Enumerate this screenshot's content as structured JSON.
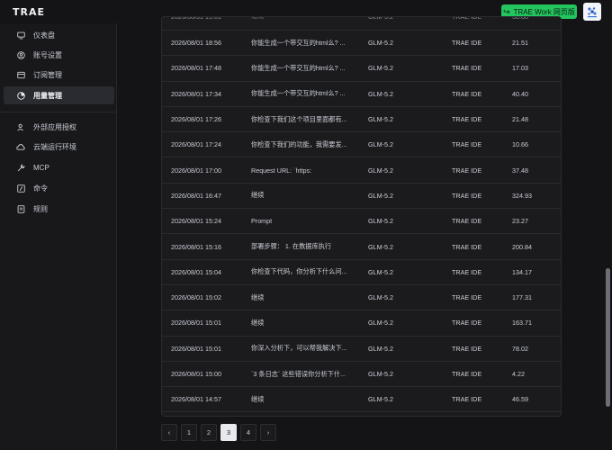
{
  "app": {
    "logo": "TRAE"
  },
  "header": {
    "work_button_label": "TRAE Work 网页版"
  },
  "sidebar": {
    "items": [
      {
        "label": "仪表盘",
        "icon": "monitor-icon"
      },
      {
        "label": "账号设置",
        "icon": "user-circle-icon"
      },
      {
        "label": "订阅管理",
        "icon": "subscription-icon"
      },
      {
        "label": "用量管理",
        "icon": "usage-icon",
        "active": true
      },
      {
        "label": "外部应用授权",
        "icon": "people-icon"
      },
      {
        "label": "云端运行环境",
        "icon": "cloud-icon"
      },
      {
        "label": "MCP",
        "icon": "wrench-icon"
      },
      {
        "label": "命令",
        "icon": "command-icon"
      },
      {
        "label": "规则",
        "icon": "rules-icon"
      }
    ]
  },
  "table": {
    "rows": [
      {
        "time": "2026/08/01 18:56",
        "query": "你能生成一个带交互的html么? ...",
        "model": "GLM-5.2",
        "source": "TRAE IDE",
        "value": "21.51"
      },
      {
        "time": "2026/08/01 17:48",
        "query": "你能生成一个带交互的html么? ...",
        "model": "GLM-5.2",
        "source": "TRAE IDE",
        "value": "17.03"
      },
      {
        "time": "2026/08/01 17:34",
        "query": "你能生成一个带交互的html么? ...",
        "model": "GLM-5.2",
        "source": "TRAE IDE",
        "value": "40.40"
      },
      {
        "time": "2026/08/01 17:26",
        "query": "你检查下我们这个项目里面都有...",
        "model": "GLM-5.2",
        "source": "TRAE IDE",
        "value": "21.48"
      },
      {
        "time": "2026/08/01 17:24",
        "query": "你检查下我们的功能，我需要发...",
        "model": "GLM-5.2",
        "source": "TRAE IDE",
        "value": "10.66"
      },
      {
        "time": "2026/08/01 17:00",
        "query": "Request URL: `https:",
        "model": "GLM-5.2",
        "source": "TRAE IDE",
        "value": "37.48"
      },
      {
        "time": "2026/08/01 16:47",
        "query": "继续",
        "model": "GLM-5.2",
        "source": "TRAE IDE",
        "value": "324.93"
      },
      {
        "time": "2026/08/01 15:24",
        "query": "Prompt",
        "model": "GLM-5.2",
        "source": "TRAE IDE",
        "value": "23.27"
      },
      {
        "time": "2026/08/01 15:16",
        "query": "部署步骤： 1. 在数据库执行",
        "model": "GLM-5.2",
        "source": "TRAE IDE",
        "value": "200.84"
      },
      {
        "time": "2026/08/01 15:04",
        "query": "你检查下代码，你分析下什么问...",
        "model": "GLM-5.2",
        "source": "TRAE IDE",
        "value": "134.17"
      },
      {
        "time": "2026/08/01 15:02",
        "query": "继续",
        "model": "GLM-5.2",
        "source": "TRAE IDE",
        "value": "177.31"
      },
      {
        "time": "2026/08/01 15:01",
        "query": "继续",
        "model": "GLM-5.2",
        "source": "TRAE IDE",
        "value": "163.71"
      },
      {
        "time": "2026/08/01 15:01",
        "query": "你深入分析下，可以帮我解决下...",
        "model": "GLM-5.2",
        "source": "TRAE IDE",
        "value": "78.02"
      },
      {
        "time": "2026/08/01 15:00",
        "query": "`3 条日志` 这些错误你分析下什...",
        "model": "GLM-5.2",
        "source": "TRAE IDE",
        "value": "4.22"
      },
      {
        "time": "2026/08/01 14:57",
        "query": "继续",
        "model": "GLM-5.2",
        "source": "TRAE IDE",
        "value": "46.59"
      }
    ]
  },
  "pagination": {
    "prev": "‹",
    "pages": [
      "1",
      "2",
      "3",
      "4"
    ],
    "current": "3",
    "next": "›"
  },
  "colors": {
    "accent": "#22c55e",
    "background": "#141416",
    "sidebar": "#18181b"
  }
}
